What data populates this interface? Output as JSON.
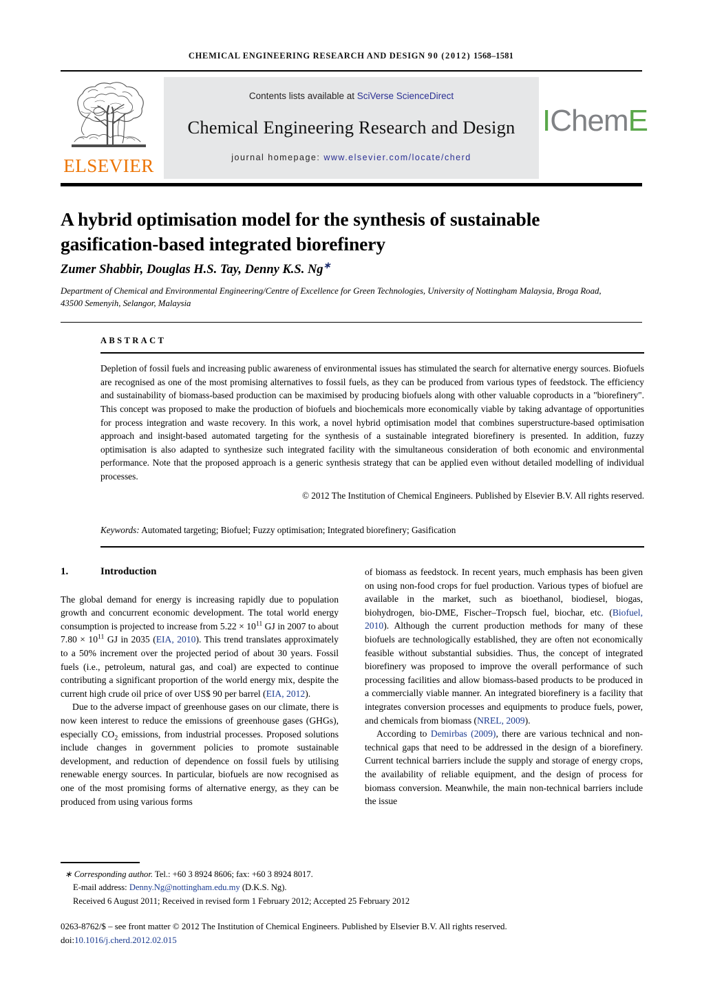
{
  "running_head": {
    "journal": "CHEMICAL ENGINEERING RESEARCH AND DESIGN",
    "volume": "90",
    "year": "(2012)",
    "pages": "1568–1581"
  },
  "masthead": {
    "contents_prefix": "Contents lists available at ",
    "contents_link": "SciVerse ScienceDirect",
    "journal_title": "Chemical Engineering Research and Design",
    "homepage_prefix": "journal homepage: ",
    "homepage_url": "www.elsevier.com/locate/cherd",
    "elsevier_wordmark": "ELSEVIER",
    "icheme_part1": "I",
    "icheme_part2": "Chem",
    "icheme_part3": "E",
    "elsevier_orange": "#ec7404",
    "icheme_green": "#5aa74a",
    "icheme_grey": "#808285",
    "link_blue": "#2a2f93",
    "band_grey": "#e6e7e8"
  },
  "article": {
    "title": "A hybrid optimisation model for the synthesis of sustainable gasification-based integrated biorefinery",
    "authors": "Zumer Shabbir, Douglas H.S. Tay, Denny K.S. Ng",
    "author_star": "∗",
    "affiliation": "Department of Chemical and Environmental Engineering/Centre of Excellence for Green Technologies, University of Nottingham Malaysia, Broga Road, 43500 Semenyih, Selangor, Malaysia"
  },
  "abstract": {
    "heading": "ABSTRACT",
    "text": "Depletion of fossil fuels and increasing public awareness of environmental issues has stimulated the search for alternative energy sources. Biofuels are recognised as one of the most promising alternatives to fossil fuels, as they can be produced from various types of feedstock. The efficiency and sustainability of biomass-based production can be maximised by producing biofuels along with other valuable coproducts in a \"biorefinery\". This concept was proposed to make the production of biofuels and biochemicals more economically viable by taking advantage of opportunities for process integration and waste recovery. In this work, a novel hybrid optimisation model that combines superstructure-based optimisation approach and insight-based automated targeting for the synthesis of a sustainable integrated biorefinery is presented. In addition, fuzzy optimisation is also adapted to synthesize such integrated facility with the simultaneous consideration of both economic and environmental performance. Note that the proposed approach is a generic synthesis strategy that can be applied even without detailed modelling of individual processes.",
    "copyright": "© 2012 The Institution of Chemical Engineers. Published by Elsevier B.V. All rights reserved.",
    "keywords_label": "Keywords:",
    "keywords_value": "Automated targeting; Biofuel; Fuzzy optimisation; Integrated biorefinery; Gasification"
  },
  "introduction": {
    "number": "1.",
    "heading": "Introduction",
    "para1_a": "The global demand for energy is increasing rapidly due to population growth and concurrent economic development. The total world energy consumption is projected to increase from 5.22 × 10",
    "para1_sup1": "11",
    "para1_b": " GJ in 2007 to about 7.80 × 10",
    "para1_sup2": "11",
    "para1_c": " GJ in 2035 (",
    "para1_cite1": "EIA, 2010",
    "para1_d": "). This trend translates approximately to a 50% increment over the projected period of about 30 years. Fossil fuels (i.e., petroleum, natural gas, and coal) are expected to continue contributing a significant proportion of the world energy mix, despite the current high crude oil price of over US$ 90 per barrel (",
    "para1_cite2": "EIA, 2012",
    "para1_e": ").",
    "para2_a": "Due to the adverse impact of greenhouse gases on our climate, there is now keen interest to reduce the emissions of greenhouse gases (GHGs), especially CO",
    "para2_sub": "2",
    "para2_b": " emissions, from industrial processes. Proposed solutions include changes in government policies to promote sustainable development, and reduction of dependence on fossil fuels by utilising renewable energy sources. In particular, biofuels are now recognised as one of the most promising forms of alternative energy, as they can be produced from using various forms",
    "para3_a": "of biomass as feedstock. In recent years, much emphasis has been given on using non-food crops for fuel production. Various types of biofuel are available in the market, such as bioethanol, biodiesel, biogas, biohydrogen, bio-DME, Fischer–Tropsch fuel, biochar, etc. (",
    "para3_cite": "Biofuel, 2010",
    "para3_b": "). Although the current production methods for many of these biofuels are technologically established, they are often not economically feasible without substantial subsidies. Thus, the concept of integrated biorefinery was proposed to improve the overall performance of such processing facilities and allow biomass-based products to be produced in a commercially viable manner. An integrated biorefinery is a facility that integrates conversion processes and equipments to produce fuels, power, and chemicals from biomass (",
    "para3_cite2": "NREL, 2009",
    "para3_c": ").",
    "para4_a": "According to ",
    "para4_cite": "Demirbas (2009)",
    "para4_b": ", there are various technical and non-technical gaps that need to be addressed in the design of a biorefinery. Current technical barriers include the supply and storage of energy crops, the availability of reliable equipment, and the design of process for biomass conversion. Meanwhile, the main non-technical barriers include the issue"
  },
  "footnotes": {
    "corr_star": "∗",
    "corr_label": "Corresponding author.",
    "corr_contact": " Tel.: +60 3 8924 8606; fax: +60 3 8924 8017.",
    "email_label": "E-mail address:",
    "email_value": "Denny.Ng@nottingham.edu.my",
    "email_suffix": "(D.K.S. Ng).",
    "dates": "Received 6 August 2011; Received in revised form 1 February 2012; Accepted 25 February 2012",
    "imprint": "0263-8762/$ – see front matter © 2012 The Institution of Chemical Engineers. Published by Elsevier B.V. All rights reserved.",
    "doi_label": "doi:",
    "doi_value": "10.1016/j.cherd.2012.02.015"
  }
}
